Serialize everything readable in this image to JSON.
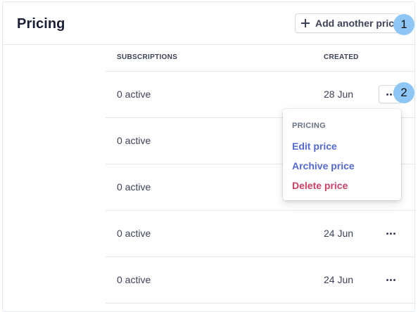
{
  "header": {
    "title": "Pricing",
    "add_button_label": "Add another price"
  },
  "markers": [
    "1",
    "2"
  ],
  "table": {
    "columns": [
      "SUBSCRIPTIONS",
      "CREATED"
    ],
    "rows": [
      {
        "subscriptions": "0 active",
        "created": "28 Jun"
      },
      {
        "subscriptions": "0 active",
        "created": ""
      },
      {
        "subscriptions": "0 active",
        "created": ""
      },
      {
        "subscriptions": "0 active",
        "created": "24 Jun"
      },
      {
        "subscriptions": "0 active",
        "created": "24 Jun"
      }
    ]
  },
  "menu": {
    "heading": "PRICING",
    "items": [
      "Edit price",
      "Archive price",
      "Delete price"
    ]
  },
  "colors": {
    "link": "#5469d4",
    "danger": "#cd3d64",
    "marker": "#8ec7f5"
  }
}
